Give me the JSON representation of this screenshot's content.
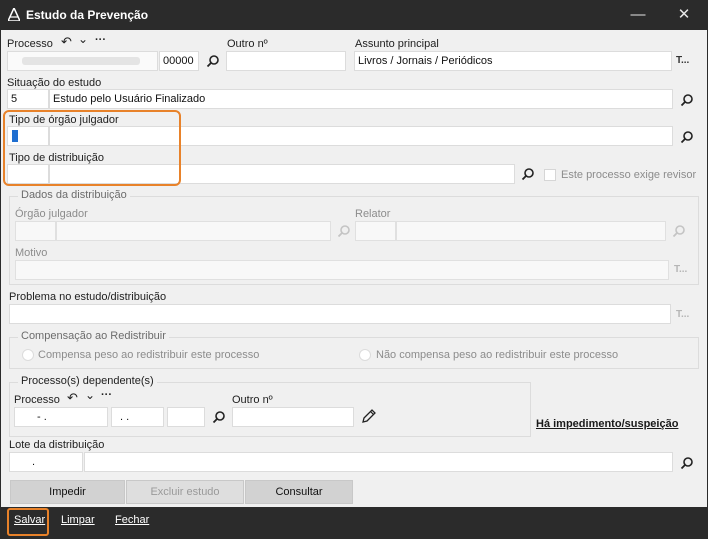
{
  "window": {
    "title": "Estudo da Prevenção",
    "minimize": "—",
    "close": "✕"
  },
  "processo": {
    "label": "Processo",
    "back_icon": "↶",
    "chevron": "⌄",
    "more": "···",
    "number_suffix": "00000"
  },
  "outro_n": {
    "label": "Outro nº",
    "value": ""
  },
  "assunto": {
    "label": "Assunto principal",
    "value": "Livros / Jornais / Periódicos",
    "trail": "T..."
  },
  "situacao": {
    "label": "Situação do estudo",
    "code": "5",
    "value": "Estudo pelo Usuário Finalizado"
  },
  "tipo_orgao": {
    "label": "Tipo de órgão julgador",
    "code": "",
    "value": ""
  },
  "tipo_distribuicao": {
    "label": "Tipo de distribuição",
    "code": "",
    "value": "",
    "checkbox_label": "Este processo exige revisor"
  },
  "dados_distribuicao": {
    "caption": "Dados da distribuição",
    "orgao_label": "Órgão julgador",
    "relator_label": "Relator",
    "motivo_label": "Motivo",
    "motivo_trail": "T..."
  },
  "problema": {
    "label": "Problema no estudo/distribuição",
    "trail": "T..."
  },
  "compensacao": {
    "caption": "Compensação ao Redistribuir",
    "option1": "Compensa peso ao redistribuir este processo",
    "option2": "Não compensa peso ao redistribuir este processo"
  },
  "dependentes": {
    "caption": "Processo(s) dependente(s)",
    "processo_label": "Processo",
    "back_icon": "↶",
    "chevron": "⌄",
    "f1": "- .",
    "f2": ". .",
    "outro_label": "Outro nº"
  },
  "impedimento_link": "Há impedimento/suspeição",
  "lote": {
    "label": "Lote da distribuição",
    "f1": "."
  },
  "actions": {
    "impedir": "Impedir",
    "excluir": "Excluir estudo",
    "consultar": "Consultar"
  },
  "footer": {
    "salvar": "Salvar",
    "limpar": "Limpar",
    "fechar": "Fechar"
  }
}
